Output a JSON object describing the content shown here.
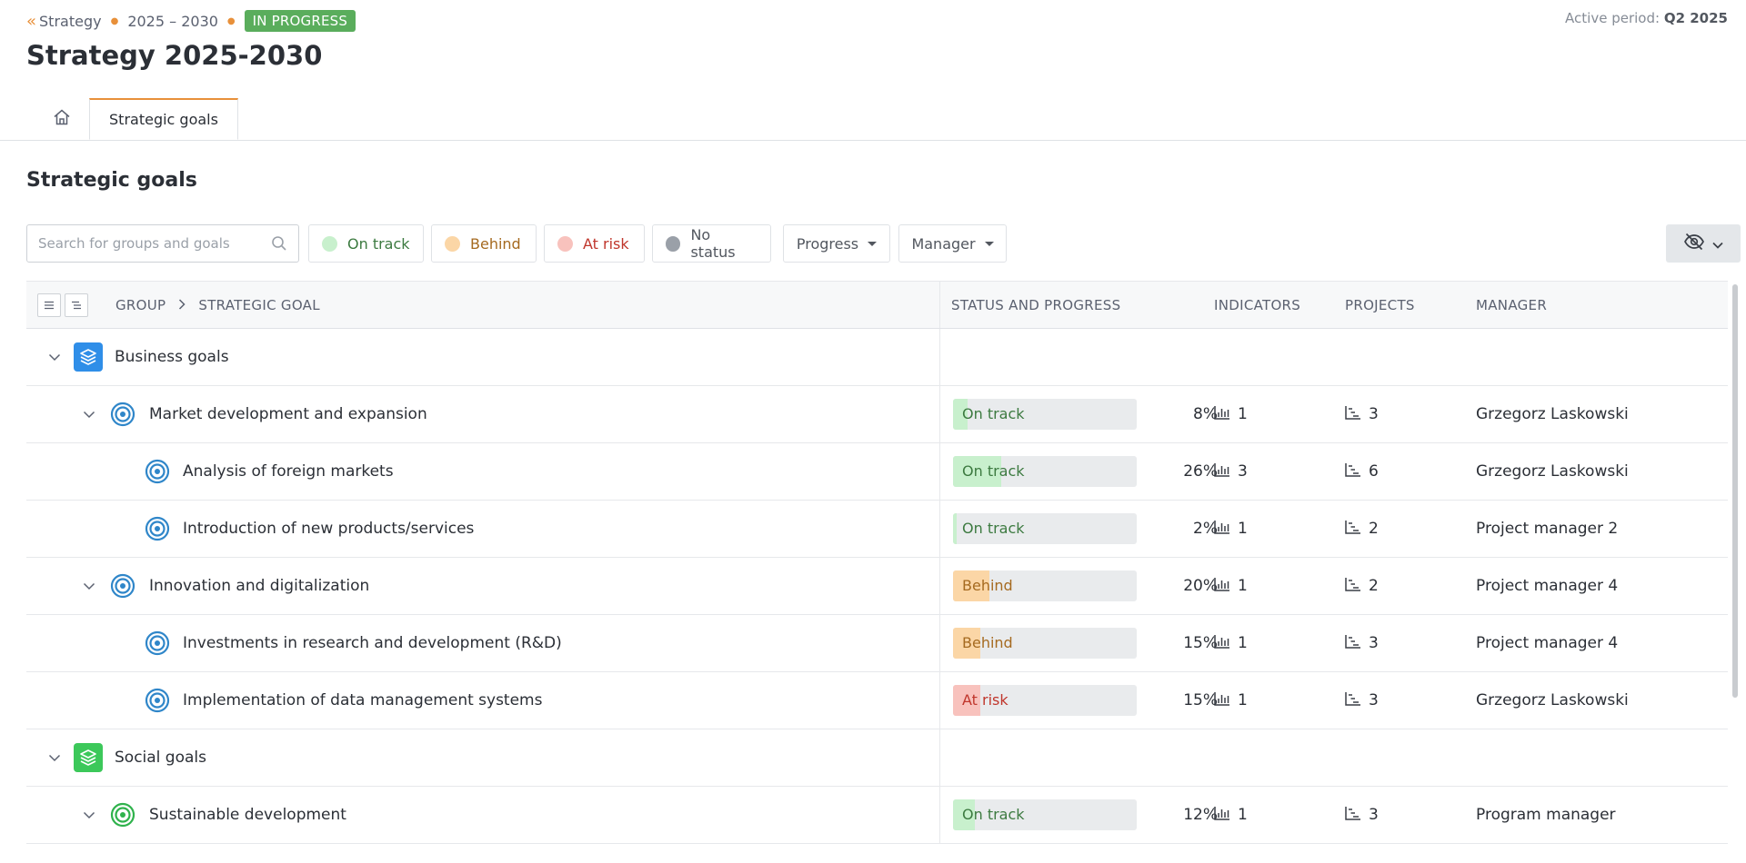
{
  "breadcrumb": {
    "parent": "Strategy",
    "period": "2025 – 2030",
    "status_badge": "IN PROGRESS"
  },
  "active_period": {
    "label": "Active period:",
    "value": "Q2 2025"
  },
  "page_title": "Strategy 2025-2030",
  "tabs": {
    "active": "Strategic goals"
  },
  "section_title": "Strategic goals",
  "toolbar": {
    "search_placeholder": "Search for groups and goals",
    "filters": {
      "on_track": "On track",
      "behind": "Behind",
      "at_risk": "At risk",
      "no_status": "No status",
      "progress": "Progress",
      "manager": "Manager"
    }
  },
  "colors": {
    "accent": "#e8903a",
    "badge_green": "#5aad5c",
    "on_track": "#c8f0cd",
    "behind": "#fbd6a6",
    "at_risk": "#f8c2bd",
    "no_status": "#9aa0a8",
    "business_group": "#2f8ee8",
    "social_group": "#3cc85a",
    "goal_blue": "#2f86c9",
    "goal_green": "#2fb24c"
  },
  "table": {
    "headers": {
      "group": "GROUP",
      "goal": "STRATEGIC GOAL",
      "status": "STATUS AND PROGRESS",
      "indicators": "INDICATORS",
      "projects": "PROJECTS",
      "manager": "MANAGER"
    },
    "rows": [
      {
        "name": "Business goals"
      },
      {
        "name": "Market development and expansion",
        "status": "On track",
        "progress_pct": "8%",
        "progress": 0.08,
        "indicators": "1",
        "projects": "3",
        "manager": "Grzegorz Laskowski"
      },
      {
        "name": "Analysis of foreign markets",
        "status": "On track",
        "progress_pct": "26%",
        "progress": 0.26,
        "indicators": "3",
        "projects": "6",
        "manager": "Grzegorz Laskowski"
      },
      {
        "name": "Introduction of new products/services",
        "status": "On track",
        "progress_pct": "2%",
        "progress": 0.02,
        "indicators": "1",
        "projects": "2",
        "manager": "Project manager 2"
      },
      {
        "name": "Innovation and digitalization",
        "status": "Behind",
        "progress_pct": "20%",
        "progress": 0.2,
        "indicators": "1",
        "projects": "2",
        "manager": "Project manager 4"
      },
      {
        "name": "Investments in research and development (R&D)",
        "status": "Behind",
        "progress_pct": "15%",
        "progress": 0.15,
        "indicators": "1",
        "projects": "3",
        "manager": "Project manager 4"
      },
      {
        "name": "Implementation of data management systems",
        "status": "At risk",
        "progress_pct": "15%",
        "progress": 0.15,
        "indicators": "1",
        "projects": "3",
        "manager": "Grzegorz Laskowski"
      },
      {
        "name": "Social goals"
      },
      {
        "name": "Sustainable development",
        "status": "On track",
        "progress_pct": "12%",
        "progress": 0.12,
        "indicators": "1",
        "projects": "3",
        "manager": "Program manager"
      }
    ]
  }
}
